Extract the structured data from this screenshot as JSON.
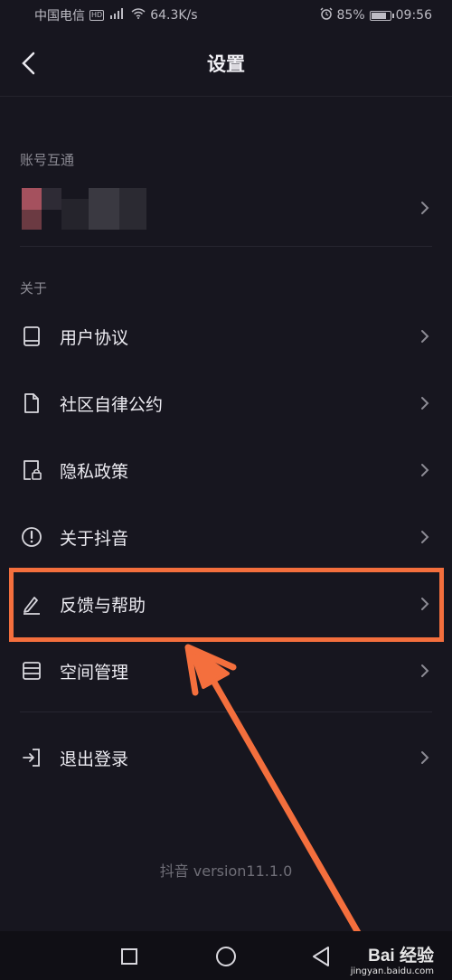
{
  "status_bar": {
    "carrier": "中国电信",
    "hd_badge": "HD",
    "signal_text": "⁴ᴳ",
    "speed": "64.3K/s",
    "battery": "85%",
    "battery_level": 0.85,
    "time": "09:56"
  },
  "header": {
    "title": "设置"
  },
  "sections": {
    "account": {
      "title": "账号互通"
    },
    "about": {
      "title": "关于"
    }
  },
  "menu": {
    "items": [
      {
        "label": "用户协议",
        "icon": "book-icon"
      },
      {
        "label": "社区自律公约",
        "icon": "document-icon"
      },
      {
        "label": "隐私政策",
        "icon": "lock-document-icon"
      },
      {
        "label": "关于抖音",
        "icon": "info-circle-icon"
      },
      {
        "label": "反馈与帮助",
        "icon": "pen-icon"
      },
      {
        "label": "空间管理",
        "icon": "storage-icon"
      }
    ],
    "logout": {
      "label": "退出登录",
      "icon": "logout-icon"
    }
  },
  "version": "抖音 version11.1.0",
  "watermark": {
    "main": "Bai 经验",
    "sub": "jingyan.baidu.com"
  },
  "colors": {
    "background": "#17161f",
    "highlight": "#f46f3d",
    "text": "#ecebf1",
    "muted": "#8c8b94"
  }
}
